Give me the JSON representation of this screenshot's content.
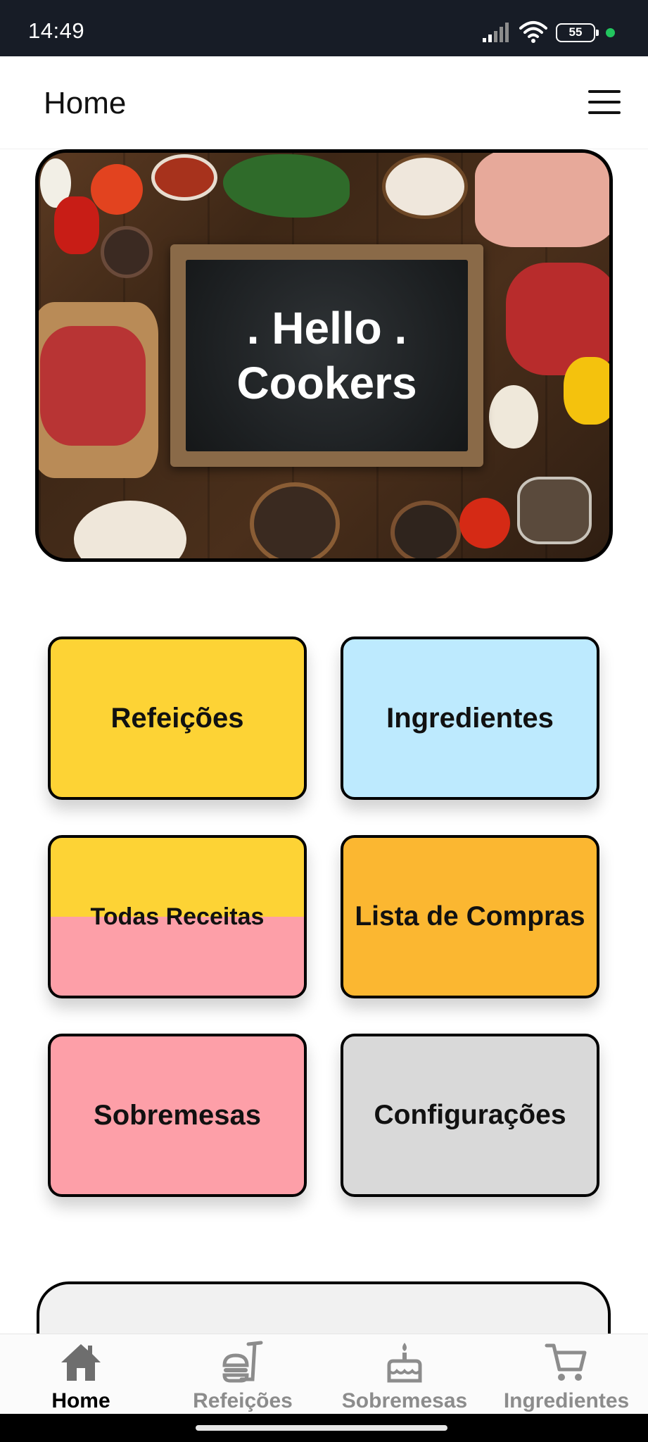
{
  "status_bar": {
    "time": "14:49",
    "battery": "55",
    "indicator_color": "#22c55e"
  },
  "app_bar": {
    "title": "Home",
    "menu_icon": "hamburger-menu-icon"
  },
  "hero": {
    "text": ". Hello .\nCookers",
    "image": "food-chalkboard-banner"
  },
  "tiles": [
    {
      "label": "Refeições",
      "color": "#fdd335"
    },
    {
      "label": "Ingredientes",
      "color": "#bdeafe"
    },
    {
      "label": "Todas Receitas",
      "colors": [
        "#fdd335",
        "#fd9fa8"
      ]
    },
    {
      "label": "Lista de Compras",
      "color": "#fbb731"
    },
    {
      "label": "Sobremesas",
      "color": "#fd9fa8"
    },
    {
      "label": "Configurações",
      "color": "#d9d9d9"
    }
  ],
  "bottom_nav": [
    {
      "label": "Home",
      "icon": "home-icon",
      "active": true
    },
    {
      "label": "Refeições",
      "icon": "fastfood-icon",
      "active": false
    },
    {
      "label": "Sobremesas",
      "icon": "cake-icon",
      "active": false
    },
    {
      "label": "Ingredientes",
      "icon": "cart-icon",
      "active": false
    }
  ]
}
